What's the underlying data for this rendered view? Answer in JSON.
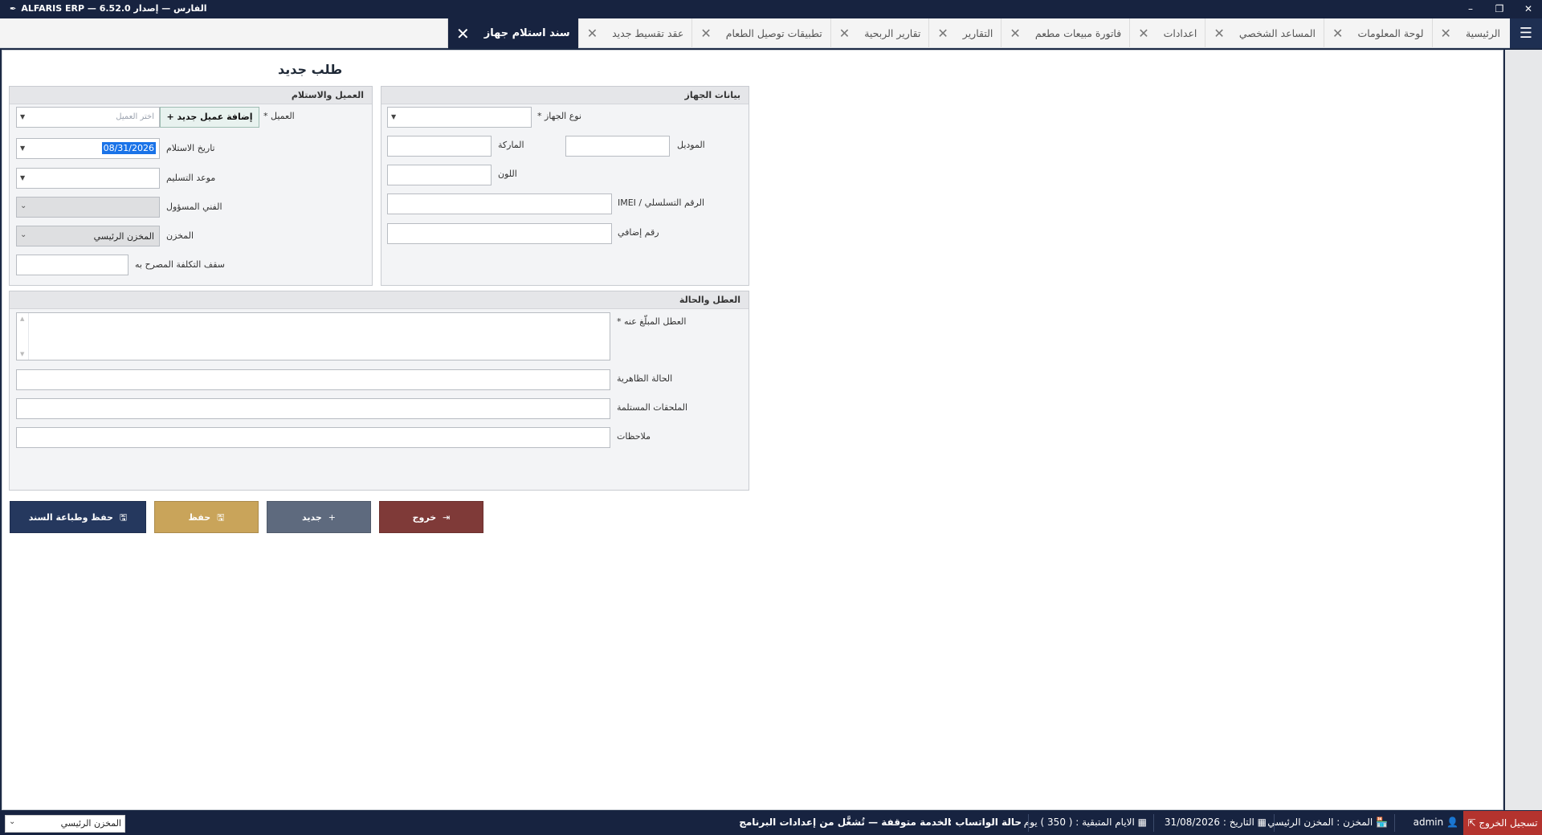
{
  "titlebar": {
    "title": "ALFARIS ERP  —  الفارس  —  إصدار 6.52.0",
    "minimize": "–",
    "restore": "❐",
    "close": "✕"
  },
  "menu_icon": "☰",
  "tabs": [
    {
      "label": "الرئيسية"
    },
    {
      "label": "لوحة المعلومات"
    },
    {
      "label": "المساعد الشخصي"
    },
    {
      "label": "اعدادات"
    },
    {
      "label": "فاتورة مبيعات مطعم"
    },
    {
      "label": "التقارير"
    },
    {
      "label": "تقارير الربحية"
    },
    {
      "label": "تطبيقات توصيل الطعام"
    },
    {
      "label": "عقد تقسيط جديد"
    },
    {
      "label": "سند استلام جهاز",
      "active": true
    }
  ],
  "page": {
    "title": "طلب جديد"
  },
  "device_panel": {
    "header": "بيانات الجهاز",
    "device_type_label": "نوع الجهاز *",
    "model_label": "الموديل",
    "brand_label": "الماركة",
    "color_label": "اللون",
    "serial_label": "الرقم التسلسلي / IMEI",
    "extra_number_label": "رقم إضافي"
  },
  "customer_panel": {
    "header": "العميل والاستلام",
    "customer_label": "العميل *",
    "customer_placeholder": "اختر العميل",
    "add_customer_button": "+ إضافة عميل جديد",
    "receive_date_label": "تاريخ الاستلام",
    "receive_date_value": "08/31/2026",
    "delivery_date_label": "موعد التسليم",
    "technician_label": "الفني المسؤول",
    "store_label": "المخزن",
    "store_value": "المخزن الرئيسي",
    "cost_cap_label": "سقف التكلفة المصرح به"
  },
  "fault_panel": {
    "header": "العطل والحالة",
    "reported_fault_label": "العطل المبلّغ عنه *",
    "appearance_label": "الحالة الظاهرية",
    "accessories_label": "الملحقات المستلمة",
    "notes_label": "ملاحظات"
  },
  "actions": {
    "save_print": "حفظ وطباعة السند",
    "save": "حفظ",
    "new": "جديد",
    "exit": "خروج"
  },
  "statusbar": {
    "logout": "تسجيل الخروج",
    "user": "admin",
    "store": "المخزن : المخزن الرئيسي",
    "date": "التاريخ : 31/08/2026",
    "remaining_days": "الايام المتبقية : ( 350 ) يوم",
    "whatsapp_label": "حالة الواتساب :",
    "whatsapp_status": "الخدمة متوقفة — تُشغَّل من إعدادات البرنامج",
    "store_select_value": "المخزن الرئيسي"
  },
  "colors": {
    "navy": "#172340",
    "save_print_btn": "#25385e",
    "save_btn": "#c9a45a",
    "new_btn": "#5e6a7e",
    "exit_btn": "#7f3a38",
    "logout_btn": "#b4332e"
  }
}
